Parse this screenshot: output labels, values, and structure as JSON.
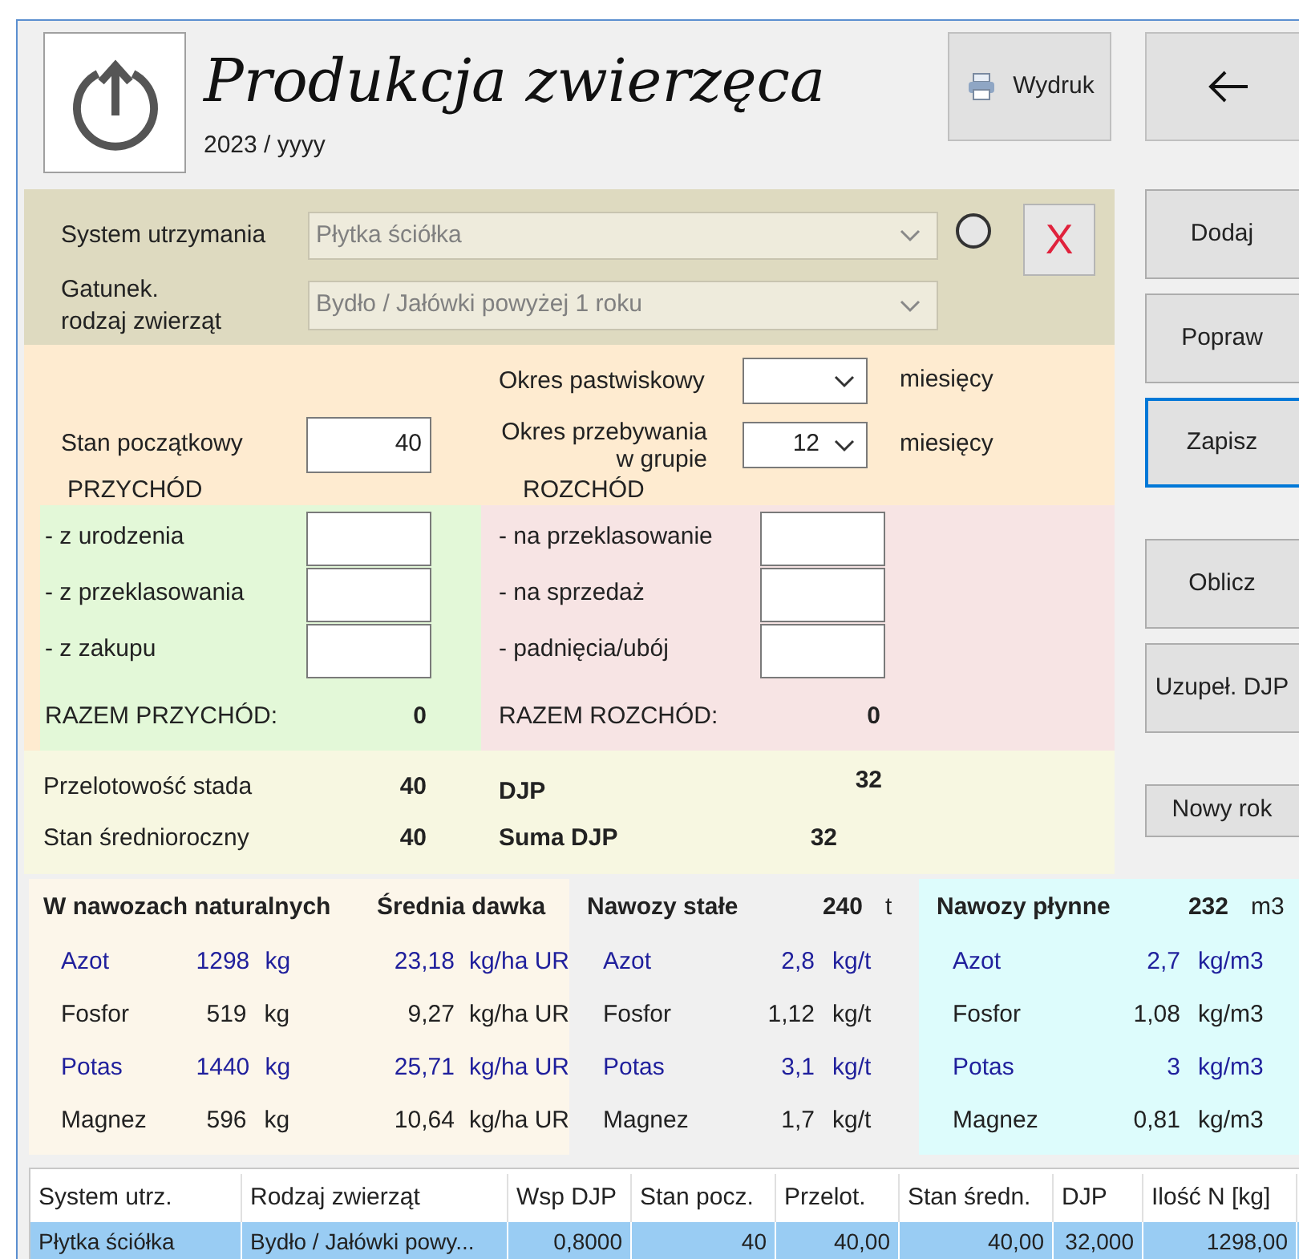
{
  "header": {
    "title": "Produkcja zwierzęca",
    "subtitle": "2023 / yyyy",
    "print_button": "Wydruk"
  },
  "selection": {
    "fields": [
      {
        "label": "System utrzymania",
        "value": "Płytka ściółka",
        "disabled": true
      },
      {
        "label": "Gatunek.\nrodzaj zwierząt",
        "value": "Bydło / Jałówki powyżej 1 roku",
        "disabled": true
      }
    ],
    "option_selected": false,
    "clear_button": "X"
  },
  "stock": {
    "initial": {
      "label": "Stan początkowy",
      "value": "40"
    },
    "periods": [
      {
        "label": "Okres pastwiskowy",
        "unit": "miesięcy"
      },
      {
        "label": "Okres przebywania\nw grupie",
        "value": "12",
        "unit": "miesięcy"
      }
    ]
  },
  "income": {
    "title": "PRZYCHÓD",
    "rows": [
      "- z urodzenia",
      "- z przeklasowania",
      "- z zakupu"
    ],
    "total_label": "RAZEM PRZYCHÓD:",
    "total": "0"
  },
  "outgo": {
    "title": "ROZCHÓD",
    "rows": [
      "- na przeklasowanie",
      "- na sprzedaż",
      "- padnięcia/ubój"
    ],
    "total_label": "RAZEM ROZCHÓD:",
    "total": "0"
  },
  "summary": [
    {
      "label": "Przelotowość stada",
      "value": "40"
    },
    {
      "label": "Stan średnioroczny",
      "value": "40"
    }
  ],
  "djp": [
    {
      "label": "DJP",
      "value": "32"
    },
    {
      "label": "Suma DJP",
      "value": "32"
    }
  ],
  "natural": {
    "title": "W nawozach naturalnych",
    "dose_title": "Średnia dawka",
    "rows": [
      {
        "name": "Azot",
        "amount": "1298",
        "unit": "kg",
        "dose": "23,18",
        "dose_unit": "kg/ha UR",
        "color": "#1f1f9c"
      },
      {
        "name": "Fosfor",
        "amount": "519",
        "unit": "kg",
        "dose": "9,27",
        "dose_unit": "kg/ha UR",
        "color": "#222222"
      },
      {
        "name": "Potas",
        "amount": "1440",
        "unit": "kg",
        "dose": "25,71",
        "dose_unit": "kg/ha UR",
        "color": "#1f1f9c"
      },
      {
        "name": "Magnez",
        "amount": "596",
        "unit": "kg",
        "dose": "10,64",
        "dose_unit": "kg/ha UR",
        "color": "#222222"
      }
    ]
  },
  "solid": {
    "title": "Nawozy stałe",
    "amount": "240",
    "unit": "t",
    "rows": [
      {
        "name": "Azot",
        "value": "2,8",
        "unit": "kg/t",
        "color": "#1f1f9c"
      },
      {
        "name": "Fosfor",
        "value": "1,12",
        "unit": "kg/t",
        "color": "#222222"
      },
      {
        "name": "Potas",
        "value": "3,1",
        "unit": "kg/t",
        "color": "#1f1f9c"
      },
      {
        "name": "Magnez",
        "value": "1,7",
        "unit": "kg/t",
        "color": "#222222"
      }
    ]
  },
  "liquid": {
    "title": "Nawozy płynne",
    "amount": "232",
    "unit": "m3",
    "rows": [
      {
        "name": "Azot",
        "value": "2,7",
        "unit": "kg/m3",
        "color": "#1f1f9c"
      },
      {
        "name": "Fosfor",
        "value": "1,08",
        "unit": "kg/m3",
        "color": "#222222"
      },
      {
        "name": "Potas",
        "value": "3",
        "unit": "kg/m3",
        "color": "#1f1f9c"
      },
      {
        "name": "Magnez",
        "value": "0,81",
        "unit": "kg/m3",
        "color": "#222222"
      }
    ]
  },
  "side_buttons": [
    [
      {
        "label": "Dodaj",
        "focused": false
      },
      {
        "label": "Popraw",
        "focused": false
      },
      {
        "label": "Zapisz",
        "focused": true
      }
    ],
    [
      {
        "label": "Oblicz",
        "focused": false
      },
      {
        "label": "Uzupeł. DJP",
        "focused": false
      }
    ],
    [
      {
        "label": "Nowy rok",
        "focused": false
      }
    ]
  ],
  "table": {
    "columns": [
      "System utrz.",
      "Rodzaj zwierząt",
      "Wsp DJP",
      "Stan pocz.",
      "Przelot.",
      "Stan średn.",
      "DJP",
      "Ilość N [kg]"
    ],
    "rows": [
      {
        "cells": [
          "Płytka ściółka",
          "Bydło / Jałówki powy...",
          "0,8000",
          "40",
          "40,00",
          "40,00",
          "32,000",
          "1298,00"
        ],
        "selected": true
      }
    ]
  }
}
